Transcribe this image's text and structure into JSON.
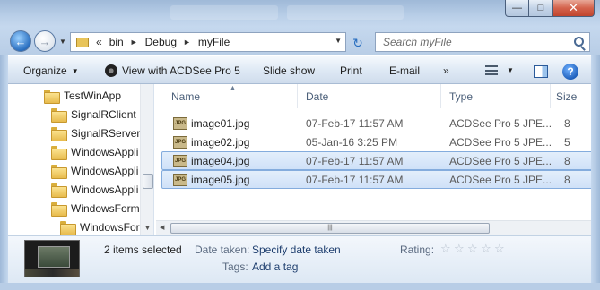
{
  "window": {
    "minimize_glyph": "—",
    "maximize_glyph": "□",
    "close_glyph": "✕"
  },
  "nav": {
    "back_glyph": "←",
    "forward_glyph": "→",
    "refresh_glyph": "↻",
    "history_icon": "chevron-down-icon"
  },
  "address": {
    "overflow": "«",
    "crumbs": [
      "bin",
      "Debug",
      "myFile"
    ],
    "separator": "►"
  },
  "search": {
    "placeholder": "Search myFile"
  },
  "toolbar": {
    "organize": "Organize",
    "view_with": "View with ACDSee Pro 5",
    "slide_show": "Slide show",
    "print": "Print",
    "email": "E-mail",
    "more": "»",
    "help": "?"
  },
  "tree": {
    "items": [
      {
        "label": "TestWinApp"
      },
      {
        "label": "SignalRClient"
      },
      {
        "label": "SignalRServer"
      },
      {
        "label": "WindowsAppli"
      },
      {
        "label": "WindowsAppli"
      },
      {
        "label": "WindowsAppli"
      },
      {
        "label": "WindowsForm"
      },
      {
        "label": "WindowsFor"
      }
    ]
  },
  "columns": {
    "name": "Name",
    "date": "Date",
    "type": "Type",
    "size": "Size"
  },
  "files": [
    {
      "name": "image01.jpg",
      "date": "07-Feb-17 11:57 AM",
      "type": "ACDSee Pro 5 JPE...",
      "size": "8",
      "selected": false
    },
    {
      "name": "image02.jpg",
      "date": "05-Jan-16 3:25 PM",
      "type": "ACDSee Pro 5 JPE...",
      "size": "5",
      "selected": false
    },
    {
      "name": "image04.jpg",
      "date": "07-Feb-17 11:57 AM",
      "type": "ACDSee Pro 5 JPE...",
      "size": "8",
      "selected": true
    },
    {
      "name": "image05.jpg",
      "date": "07-Feb-17 11:57 AM",
      "type": "ACDSee Pro 5 JPE...",
      "size": "8",
      "selected": true
    }
  ],
  "file_icon_text": "JPG",
  "details": {
    "selection": "2 items selected",
    "date_taken_label": "Date taken:",
    "date_taken_value": "Specify date taken",
    "tags_label": "Tags:",
    "tags_value": "Add a tag",
    "rating_label": "Rating:",
    "rating_stars": 5,
    "rating_value": 0
  }
}
